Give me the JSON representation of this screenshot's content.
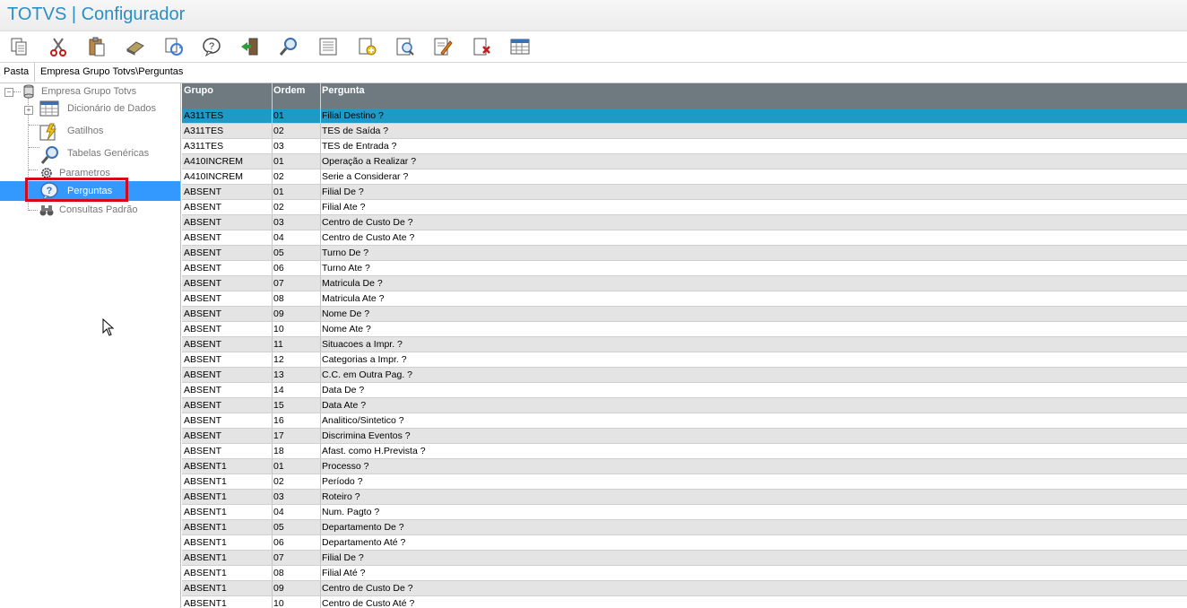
{
  "app": {
    "title": "TOTVS | Configurador"
  },
  "toolbar": {
    "buttons": [
      {
        "icon": "copy-icon"
      },
      {
        "icon": "cut-icon"
      },
      {
        "icon": "paste-icon"
      },
      {
        "icon": "eraser-icon"
      },
      {
        "icon": "refresh-icon"
      },
      {
        "icon": "help-icon"
      },
      {
        "icon": "exit-icon"
      },
      {
        "icon": "search-icon"
      },
      {
        "icon": "list-icon"
      },
      {
        "icon": "new-document-icon"
      },
      {
        "icon": "preview-icon"
      },
      {
        "icon": "edit-icon"
      },
      {
        "icon": "delete-icon"
      },
      {
        "icon": "table-icon"
      }
    ]
  },
  "pasta": {
    "label": "Pasta",
    "path": "Empresa Grupo Totvs\\Perguntas"
  },
  "tree": {
    "root": "Empresa Grupo Totvs",
    "items": [
      {
        "label": "Dicionário de Dados",
        "icon": "table-icon"
      },
      {
        "label": "Gatilhos",
        "icon": "trigger-icon"
      },
      {
        "label": "Tabelas Genéricas",
        "icon": "magnifier-icon"
      },
      {
        "label": "Parametros",
        "icon": "gear-icon"
      },
      {
        "label": "Perguntas",
        "icon": "question-icon"
      },
      {
        "label": "Consultas Padrão",
        "icon": "binoculars-icon"
      }
    ]
  },
  "grid": {
    "columns": [
      "Grupo",
      "Ordem",
      "Pergunta"
    ],
    "rows": [
      [
        "A311TES",
        "01",
        "Filial Destino ?"
      ],
      [
        "A311TES",
        "02",
        "TES de Saída ?"
      ],
      [
        "A311TES",
        "03",
        "TES de Entrada ?"
      ],
      [
        "A410INCREM",
        "01",
        "Operação a Realizar ?"
      ],
      [
        "A410INCREM",
        "02",
        "Serie a Considerar ?"
      ],
      [
        "ABSENT",
        "01",
        "Filial De ?"
      ],
      [
        "ABSENT",
        "02",
        "Filial Ate ?"
      ],
      [
        "ABSENT",
        "03",
        "Centro de Custo De ?"
      ],
      [
        "ABSENT",
        "04",
        "Centro de Custo Ate ?"
      ],
      [
        "ABSENT",
        "05",
        "Turno De ?"
      ],
      [
        "ABSENT",
        "06",
        "Turno Ate ?"
      ],
      [
        "ABSENT",
        "07",
        "Matricula De ?"
      ],
      [
        "ABSENT",
        "08",
        "Matricula Ate ?"
      ],
      [
        "ABSENT",
        "09",
        "Nome De ?"
      ],
      [
        "ABSENT",
        "10",
        "Nome Ate ?"
      ],
      [
        "ABSENT",
        "11",
        "Situacoes a Impr. ?"
      ],
      [
        "ABSENT",
        "12",
        "Categorias a Impr. ?"
      ],
      [
        "ABSENT",
        "13",
        "C.C. em Outra Pag. ?"
      ],
      [
        "ABSENT",
        "14",
        "Data De ?"
      ],
      [
        "ABSENT",
        "15",
        "Data Ate ?"
      ],
      [
        "ABSENT",
        "16",
        "Analitico/Sintetico ?"
      ],
      [
        "ABSENT",
        "17",
        "Discrimina Eventos ?"
      ],
      [
        "ABSENT",
        "18",
        "Afast. como H.Prevista ?"
      ],
      [
        "ABSENT1",
        "01",
        "Processo ?"
      ],
      [
        "ABSENT1",
        "02",
        "Período ?"
      ],
      [
        "ABSENT1",
        "03",
        "Roteiro ?"
      ],
      [
        "ABSENT1",
        "04",
        "Num. Pagto ?"
      ],
      [
        "ABSENT1",
        "05",
        "Departamento De ?"
      ],
      [
        "ABSENT1",
        "06",
        "Departamento Até ?"
      ],
      [
        "ABSENT1",
        "07",
        "Filial De ?"
      ],
      [
        "ABSENT1",
        "08",
        "Filial Até ?"
      ],
      [
        "ABSENT1",
        "09",
        "Centro de Custo De ?"
      ],
      [
        "ABSENT1",
        "10",
        "Centro de Custo Até ?"
      ]
    ]
  },
  "colors": {
    "accent": "#2a8fc4",
    "header": "#6f7a80",
    "selected_row": "#1f9ac4",
    "tree_selected": "#3399ff",
    "highlight_box": "#d40a1a"
  }
}
